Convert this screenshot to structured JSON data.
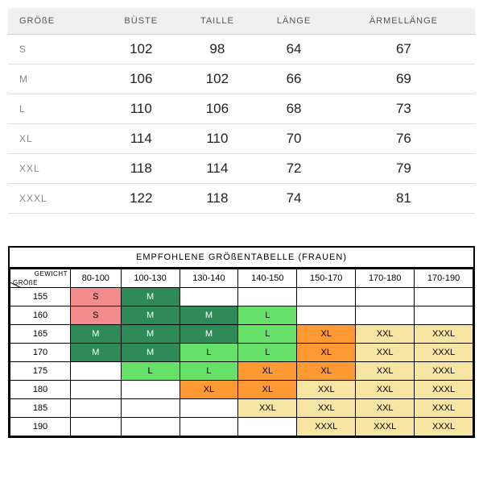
{
  "top": {
    "headers": [
      "GRÖßE",
      "BÜSTE",
      "TAILLE",
      "LÄNGE",
      "ÄRMELLÄNGE"
    ],
    "rows": [
      {
        "size": "S",
        "bust": "102",
        "waist": "98",
        "length": "64",
        "sleeve": "67"
      },
      {
        "size": "M",
        "bust": "106",
        "waist": "102",
        "length": "66",
        "sleeve": "69"
      },
      {
        "size": "L",
        "bust": "110",
        "waist": "106",
        "length": "68",
        "sleeve": "73"
      },
      {
        "size": "XL",
        "bust": "114",
        "waist": "110",
        "length": "70",
        "sleeve": "76"
      },
      {
        "size": "XXL",
        "bust": "118",
        "waist": "114",
        "length": "72",
        "sleeve": "79"
      },
      {
        "size": "XXXL",
        "bust": "122",
        "waist": "118",
        "length": "74",
        "sleeve": "81"
      }
    ]
  },
  "bottom": {
    "title": "EMPFOHLENE GRÖßENTABELLE (FRAUEN)",
    "corner_top": "GEWICHT",
    "corner_bottom": "GRÖßE",
    "weights": [
      "80-100",
      "100-130",
      "130-140",
      "140-150",
      "150-170",
      "170-180",
      "170-190"
    ],
    "heights": [
      "155",
      "160",
      "165",
      "170",
      "175",
      "180",
      "185",
      "190"
    ],
    "cells": [
      [
        {
          "v": "S",
          "c": "pink"
        },
        {
          "v": "M",
          "c": "dgreen"
        },
        {
          "v": "",
          "c": ""
        },
        {
          "v": "",
          "c": ""
        },
        {
          "v": "",
          "c": ""
        },
        {
          "v": "",
          "c": ""
        },
        {
          "v": "",
          "c": ""
        }
      ],
      [
        {
          "v": "S",
          "c": "pink"
        },
        {
          "v": "M",
          "c": "dgreen"
        },
        {
          "v": "M",
          "c": "dgreen"
        },
        {
          "v": "L",
          "c": "lgreen"
        },
        {
          "v": "",
          "c": ""
        },
        {
          "v": "",
          "c": ""
        },
        {
          "v": "",
          "c": ""
        }
      ],
      [
        {
          "v": "M",
          "c": "dgreen"
        },
        {
          "v": "M",
          "c": "dgreen"
        },
        {
          "v": "M",
          "c": "dgreen"
        },
        {
          "v": "L",
          "c": "lgreen"
        },
        {
          "v": "XL",
          "c": "orange"
        },
        {
          "v": "XXL",
          "c": "cream"
        },
        {
          "v": "XXXL",
          "c": "cream"
        }
      ],
      [
        {
          "v": "M",
          "c": "dgreen"
        },
        {
          "v": "M",
          "c": "dgreen"
        },
        {
          "v": "L",
          "c": "lgreen"
        },
        {
          "v": "L",
          "c": "lgreen"
        },
        {
          "v": "XL",
          "c": "orange"
        },
        {
          "v": "XXL",
          "c": "cream"
        },
        {
          "v": "XXXL",
          "c": "cream"
        }
      ],
      [
        {
          "v": "",
          "c": ""
        },
        {
          "v": "L",
          "c": "lgreen"
        },
        {
          "v": "L",
          "c": "lgreen"
        },
        {
          "v": "XL",
          "c": "orange"
        },
        {
          "v": "XL",
          "c": "orange"
        },
        {
          "v": "XXL",
          "c": "cream"
        },
        {
          "v": "XXXL",
          "c": "cream"
        }
      ],
      [
        {
          "v": "",
          "c": ""
        },
        {
          "v": "",
          "c": ""
        },
        {
          "v": "XL",
          "c": "orange"
        },
        {
          "v": "XL",
          "c": "orange"
        },
        {
          "v": "XXL",
          "c": "cream"
        },
        {
          "v": "XXL",
          "c": "cream"
        },
        {
          "v": "XXXL",
          "c": "cream"
        }
      ],
      [
        {
          "v": "",
          "c": ""
        },
        {
          "v": "",
          "c": ""
        },
        {
          "v": "",
          "c": ""
        },
        {
          "v": "XXL",
          "c": "cream"
        },
        {
          "v": "XXL",
          "c": "cream"
        },
        {
          "v": "XXL",
          "c": "cream"
        },
        {
          "v": "XXXL",
          "c": "cream"
        }
      ],
      [
        {
          "v": "",
          "c": ""
        },
        {
          "v": "",
          "c": ""
        },
        {
          "v": "",
          "c": ""
        },
        {
          "v": "",
          "c": ""
        },
        {
          "v": "XXXL",
          "c": "cream"
        },
        {
          "v": "XXXL",
          "c": "cream"
        },
        {
          "v": "XXXL",
          "c": "cream"
        }
      ]
    ]
  },
  "chart_data": {
    "type": "table",
    "tables": [
      {
        "title": "Size measurements",
        "columns": [
          "GRÖßE",
          "BÜSTE",
          "TAILLE",
          "LÄNGE",
          "ÄRMELLÄNGE"
        ],
        "rows": [
          [
            "S",
            102,
            98,
            64,
            67
          ],
          [
            "M",
            106,
            102,
            66,
            69
          ],
          [
            "L",
            110,
            106,
            68,
            73
          ],
          [
            "XL",
            114,
            110,
            70,
            76
          ],
          [
            "XXL",
            118,
            114,
            72,
            79
          ],
          [
            "XXXL",
            122,
            118,
            74,
            81
          ]
        ]
      },
      {
        "title": "EMPFOHLENE GRÖßENTABELLE (FRAUEN)",
        "row_axis": "GRÖßE (cm)",
        "col_axis": "GEWICHT",
        "columns": [
          "80-100",
          "100-130",
          "130-140",
          "140-150",
          "150-170",
          "170-180",
          "170-190"
        ],
        "rows": {
          "155": [
            "S",
            "M",
            "",
            "",
            "",
            "",
            ""
          ],
          "160": [
            "S",
            "M",
            "M",
            "L",
            "",
            "",
            ""
          ],
          "165": [
            "M",
            "M",
            "M",
            "L",
            "XL",
            "XXL",
            "XXXL"
          ],
          "170": [
            "M",
            "M",
            "L",
            "L",
            "XL",
            "XXL",
            "XXXL"
          ],
          "175": [
            "",
            "L",
            "L",
            "XL",
            "XL",
            "XXL",
            "XXXL"
          ],
          "180": [
            "",
            "",
            "XL",
            "XL",
            "XXL",
            "XXL",
            "XXXL"
          ],
          "185": [
            "",
            "",
            "",
            "XXL",
            "XXL",
            "XXL",
            "XXXL"
          ],
          "190": [
            "",
            "",
            "",
            "",
            "XXXL",
            "XXXL",
            "XXXL"
          ]
        }
      }
    ]
  }
}
